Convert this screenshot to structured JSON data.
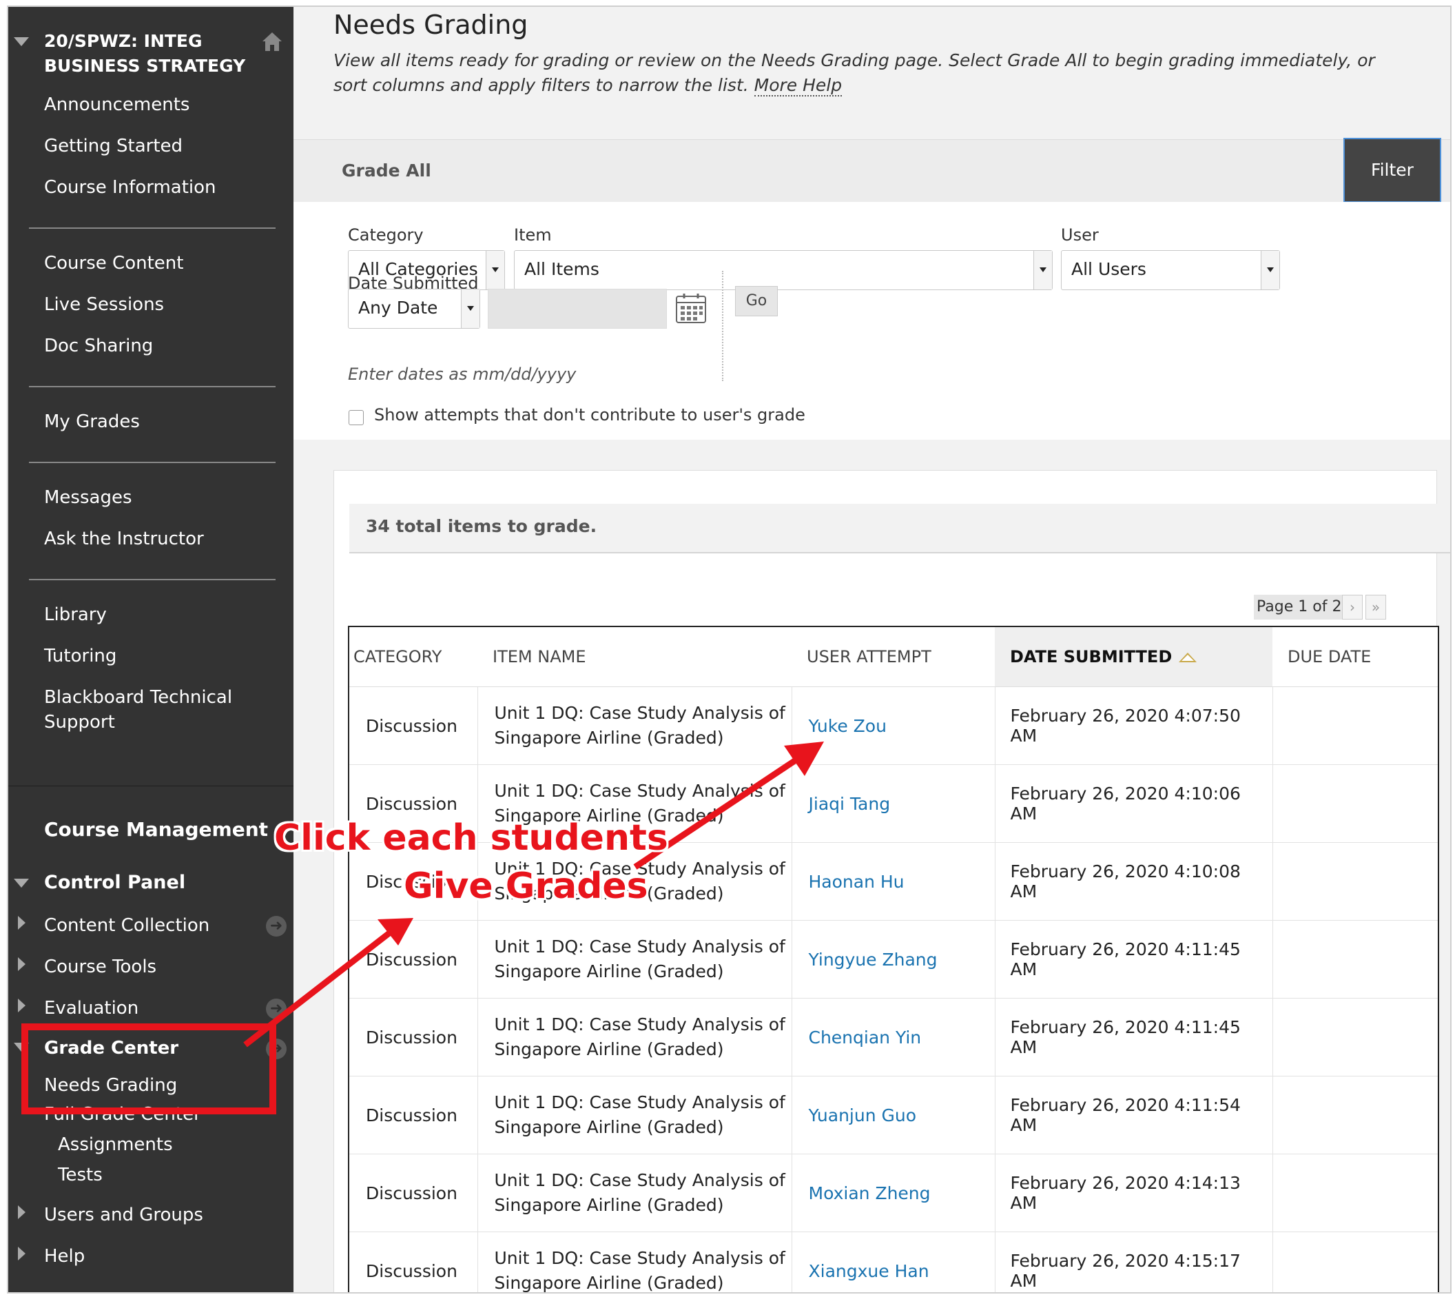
{
  "sidebar": {
    "course_title": "20/SPWZ: INTEG BUSINESS STRATEGY",
    "groups": [
      [
        "Announcements",
        "Getting Started",
        "Course Information"
      ],
      [
        "Course Content",
        "Live Sessions",
        "Doc Sharing"
      ],
      [
        "My Grades"
      ],
      [
        "Messages",
        "Ask the Instructor"
      ],
      [
        "Library",
        "Tutoring",
        "Blackboard Technical Support"
      ]
    ],
    "management": {
      "title": "Course Management",
      "control_panel": "Control Panel",
      "items": {
        "content_collection": "Content Collection",
        "course_tools": "Course Tools",
        "evaluation": "Evaluation",
        "grade_center": "Grade Center",
        "needs_grading": "Needs Grading",
        "full_grade_center": "Full Grade Center",
        "assignments": "Assignments",
        "tests": "Tests",
        "users_groups": "Users and Groups",
        "help": "Help"
      }
    }
  },
  "page": {
    "title": "Needs Grading",
    "description": "View all items ready for grading or review on the Needs Grading page. Select Grade All to begin grading immediately, or sort columns and apply filters to narrow the list.",
    "more_help": "More Help"
  },
  "actions": {
    "grade_all": "Grade All",
    "filter": "Filter"
  },
  "filters": {
    "category_label": "Category",
    "category_value": "All Categories",
    "item_label": "Item",
    "item_value": "All Items",
    "user_label": "User",
    "user_value": "All Users",
    "date_label": "Date Submitted",
    "date_value": "Any Date",
    "go": "Go",
    "date_hint": "Enter dates as mm/dd/yyyy",
    "show_attempts": "Show attempts that don't contribute to user's grade"
  },
  "results": {
    "total": "34 total items to grade.",
    "pager": "Page 1 of 2",
    "columns": [
      "CATEGORY",
      "ITEM NAME",
      "USER ATTEMPT",
      "DATE SUBMITTED",
      "DUE DATE"
    ],
    "rows": [
      {
        "category": "Discussion",
        "item": "Unit 1 DQ: Case Study Analysis of Singapore Airline (Graded)",
        "user": "Yuke Zou",
        "date": "February 26, 2020 4:07:50 AM",
        "due": ""
      },
      {
        "category": "Discussion",
        "item": "Unit 1 DQ: Case Study Analysis of Singapore Airline (Graded)",
        "user": "Jiaqi Tang",
        "date": "February 26, 2020 4:10:06 AM",
        "due": ""
      },
      {
        "category": "Discussion",
        "item": "Unit 1 DQ: Case Study Analysis of Singapore Airline (Graded)",
        "user": "Haonan Hu",
        "date": "February 26, 2020 4:10:08 AM",
        "due": ""
      },
      {
        "category": "Discussion",
        "item": "Unit 1 DQ: Case Study Analysis of Singapore Airline (Graded)",
        "user": "Yingyue Zhang",
        "date": "February 26, 2020 4:11:45 AM",
        "due": ""
      },
      {
        "category": "Discussion",
        "item": "Unit 1 DQ: Case Study Analysis of Singapore Airline (Graded)",
        "user": "Chenqian Yin",
        "date": "February 26, 2020 4:11:45 AM",
        "due": ""
      },
      {
        "category": "Discussion",
        "item": "Unit 1 DQ: Case Study Analysis of Singapore Airline (Graded)",
        "user": "Yuanjun Guo",
        "date": "February 26, 2020 4:11:54 AM",
        "due": ""
      },
      {
        "category": "Discussion",
        "item": "Unit 1 DQ: Case Study Analysis of Singapore Airline (Graded)",
        "user": "Moxian Zheng",
        "date": "February 26, 2020 4:14:13 AM",
        "due": ""
      },
      {
        "category": "Discussion",
        "item": "Unit 1 DQ: Case Study Analysis of Singapore Airline (Graded)",
        "user": "Xiangxue Han",
        "date": "February 26, 2020 4:15:17 AM",
        "due": ""
      }
    ]
  },
  "annotation": {
    "line1": "Click each students",
    "line2": "Give Grades",
    "color": "#e8141c"
  }
}
